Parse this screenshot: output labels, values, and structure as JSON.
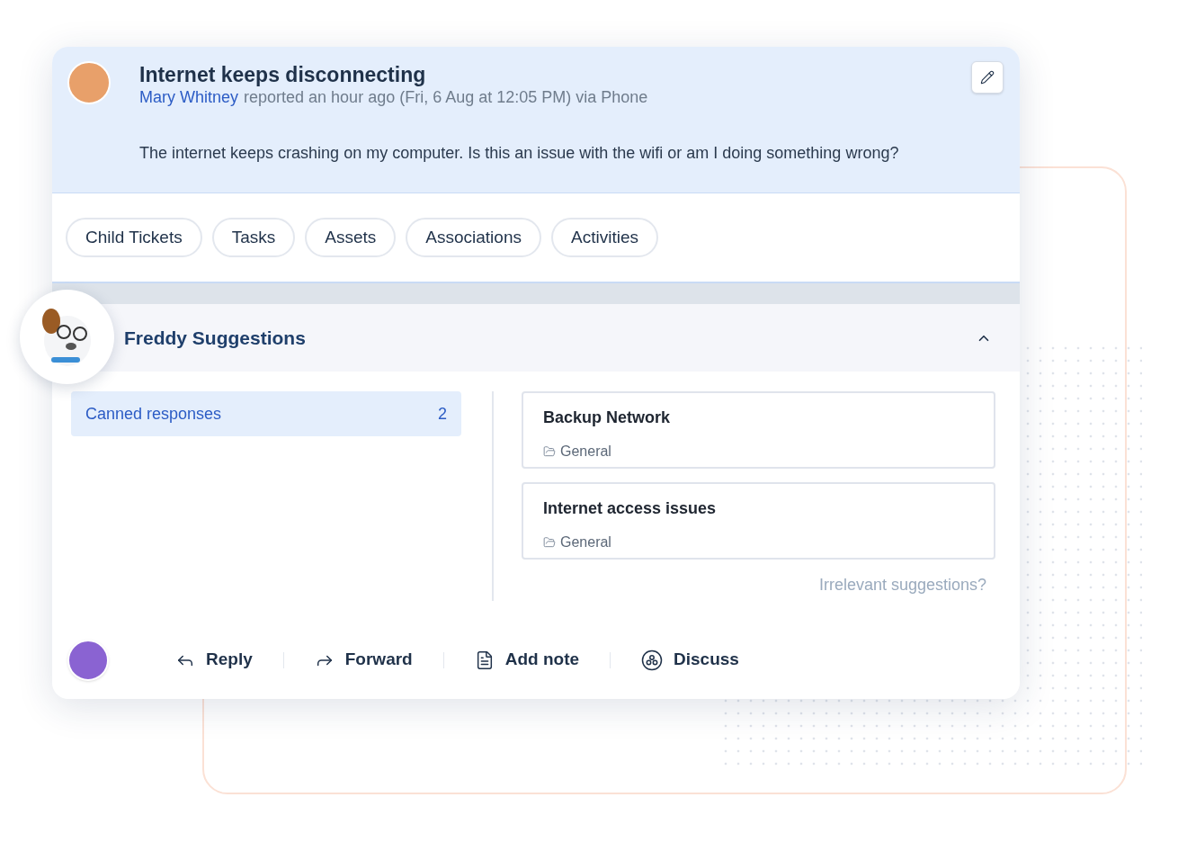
{
  "ticket": {
    "title": "Internet keeps disconnecting",
    "requester": "Mary Whitney",
    "meta": "reported an hour ago (Fri, 6 Aug at 12:05 PM) via Phone",
    "description": "The internet keeps crashing on my computer. Is this an issue with the wifi or am I doing something wrong?"
  },
  "tabs": [
    {
      "label": "Child Tickets"
    },
    {
      "label": "Tasks"
    },
    {
      "label": "Assets"
    },
    {
      "label": "Associations"
    },
    {
      "label": "Activities"
    }
  ],
  "freddy": {
    "title": "Freddy Suggestions",
    "expanded": true
  },
  "categories": [
    {
      "label": "Canned responses",
      "count": "2",
      "selected": true
    }
  ],
  "suggestions": [
    {
      "title": "Backup Network",
      "folder": "General"
    },
    {
      "title": "Internet access issues",
      "folder": "General"
    }
  ],
  "irrelevant_link": "Irrelevant suggestions?",
  "actions": [
    {
      "label": "Reply",
      "kind": "reply"
    },
    {
      "label": "Forward",
      "kind": "forward"
    },
    {
      "label": "Add note",
      "kind": "note"
    },
    {
      "label": "Discuss",
      "kind": "discuss"
    }
  ]
}
